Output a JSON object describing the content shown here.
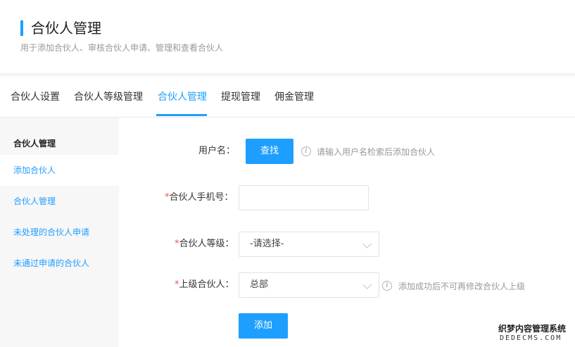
{
  "header": {
    "title": "合伙人管理",
    "subtitle": "用于添加合伙人、审核合伙人申请、管理和查看合伙人"
  },
  "tabs": [
    {
      "label": "合伙人设置"
    },
    {
      "label": "合伙人等级管理"
    },
    {
      "label": "合伙人管理"
    },
    {
      "label": "提现管理"
    },
    {
      "label": "佣金管理"
    }
  ],
  "sidebar": {
    "heading": "合伙人管理",
    "items": [
      {
        "label": "添加合伙人"
      },
      {
        "label": "合伙人管理"
      },
      {
        "label": "未处理的合伙人申请"
      },
      {
        "label": "未通过申请的合伙人"
      }
    ]
  },
  "form": {
    "username_label": "用户名：",
    "search_button": "查找",
    "username_tip": "请输入用户名检索后添加合伙人",
    "phone_label": "合伙人手机号：",
    "phone_value": "",
    "level_label": "合伙人等级：",
    "level_value": "-请选择-",
    "parent_label": "上级合伙人：",
    "parent_value": "总部",
    "parent_tip": "添加成功后不可再修改合伙人上级",
    "required_mark": "*",
    "tip_icon_glyph": "i",
    "submit_button": "添加"
  },
  "watermark": {
    "text": "织梦内容管理系统",
    "domain": "DEDECMS.COM"
  },
  "colors": {
    "accent": "#1e9fff",
    "required": "#ff4d4f"
  }
}
